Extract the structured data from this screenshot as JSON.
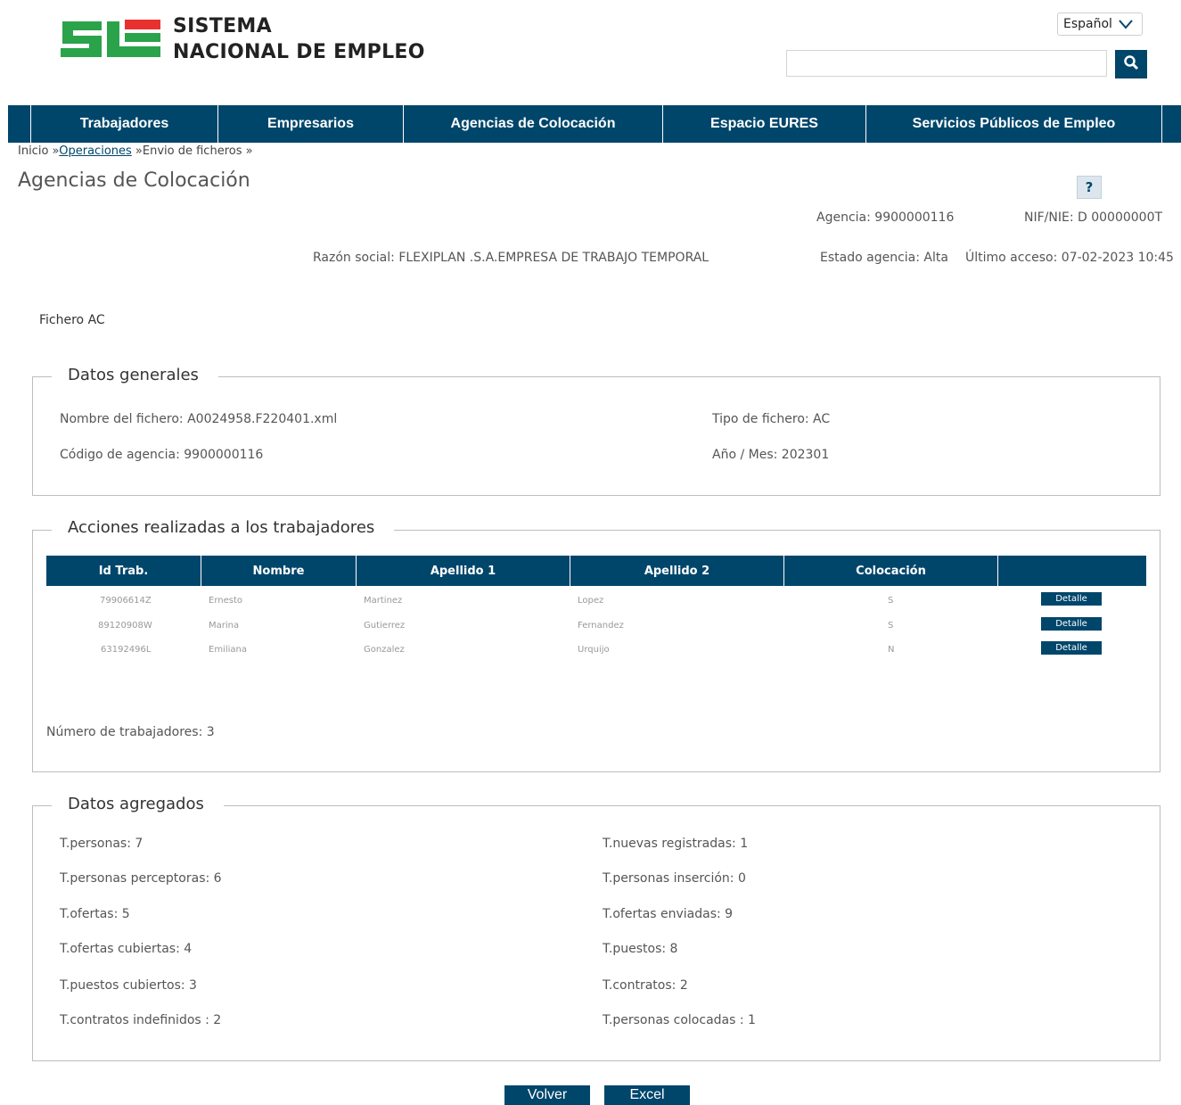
{
  "header": {
    "brand_line1": "SISTEMA",
    "brand_line2": "NACIONAL DE EMPLEO",
    "language": "Español",
    "search_value": ""
  },
  "nav": {
    "items": [
      "Trabajadores",
      "Empresarios",
      "Agencias de Colocación",
      "Espacio EURES",
      "Servicios Públicos de Empleo"
    ]
  },
  "breadcrumb": {
    "home": "Inicio",
    "sep1": " »",
    "operaciones": "Operaciones",
    "sep2": " »",
    "current": "Envio de ficheros",
    "sep3": " »"
  },
  "page": {
    "title": "Agencias de Colocación",
    "help": "?",
    "agencia": "Agencia: 9900000116",
    "nif": "NIF/NIE: D 00000000T",
    "razon_social": "Razón social: FLEXIPLAN .S.A.EMPRESA DE TRABAJO TEMPORAL",
    "estado": "Estado agencia: Alta",
    "ultimo_acceso": "Último acceso: 07-02-2023 10:45",
    "section_label": "Fichero AC"
  },
  "datos_generales": {
    "legend": "Datos generales",
    "nombre_fichero": "Nombre del fichero: A0024958.F220401.xml",
    "tipo_fichero": "Tipo de fichero: AC",
    "codigo_agencia": "Código de agencia: 9900000116",
    "anio_mes": "Año / Mes: 202301"
  },
  "acciones": {
    "legend": "Acciones realizadas a los trabajadores",
    "columns": [
      "Id Trab.",
      "Nombre",
      "Apellido 1",
      "Apellido 2",
      "Colocación",
      ""
    ],
    "rows": [
      {
        "id": "79906614Z",
        "nombre": "Ernesto",
        "apellido1": "Martinez",
        "apellido2": "Lopez",
        "colocacion": "S",
        "action": "Detalle"
      },
      {
        "id": "89120908W",
        "nombre": "Marina",
        "apellido1": "Gutierrez",
        "apellido2": "Fernandez",
        "colocacion": "S",
        "action": "Detalle"
      },
      {
        "id": "63192496L",
        "nombre": "Emiliana",
        "apellido1": "Gonzalez",
        "apellido2": "Urquijo",
        "colocacion": "N",
        "action": "Detalle"
      }
    ],
    "numero": "Número de trabajadores: 3"
  },
  "agregados": {
    "legend": "Datos agregados",
    "left": [
      "T.personas: 7",
      "T.personas perceptoras: 6",
      "T.ofertas: 5",
      "T.ofertas cubiertas: 4",
      "T.puestos cubiertos: 3",
      "T.contratos indefinidos : 2"
    ],
    "right": [
      "T.nuevas registradas: 1",
      "T.personas inserción: 0",
      "T.ofertas enviadas: 9",
      "T.puestos: 8",
      "T.contratos: 2",
      "T.personas colocadas : 1"
    ]
  },
  "buttons": {
    "volver": "Volver",
    "excel": "Excel"
  },
  "colors": {
    "primary": "#00466b",
    "logo_green": "#2aa34a",
    "logo_red": "#e8312f"
  }
}
